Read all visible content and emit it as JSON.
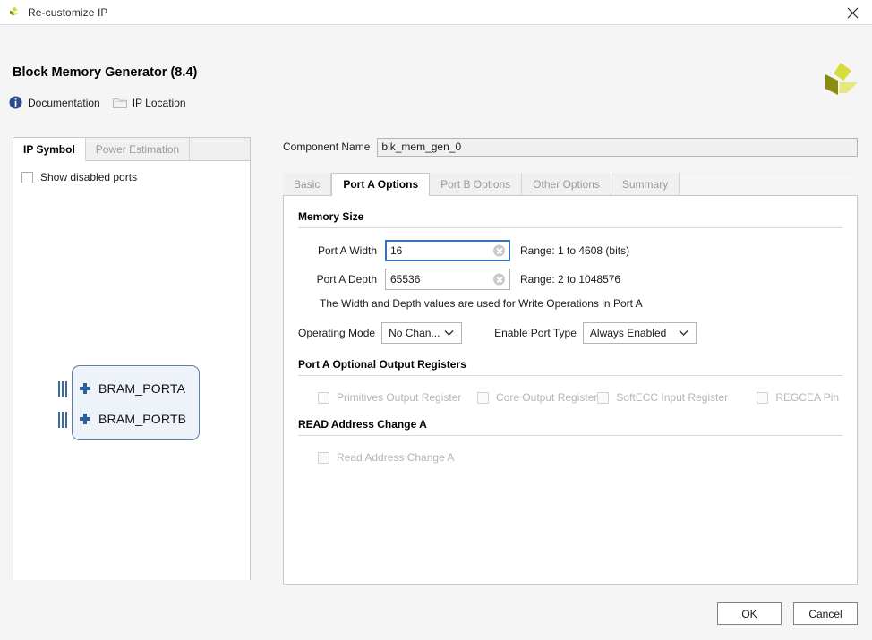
{
  "window": {
    "title": "Re-customize IP",
    "app_icon": "xilinx-logo-icon",
    "close_icon": "close-icon"
  },
  "header": {
    "title": "Block Memory Generator (8.4)",
    "logo_icon": "xilinx-pinwheel-logo"
  },
  "links": [
    {
      "label": "Documentation",
      "icon": "info-icon"
    },
    {
      "label": "IP Location",
      "icon": "folder-icon"
    }
  ],
  "left_panel": {
    "tabs": [
      {
        "label": "IP Symbol",
        "active": true
      },
      {
        "label": "Power Estimation",
        "active": false
      }
    ],
    "show_disabled_ports": {
      "label": "Show disabled ports",
      "checked": false
    },
    "symbol": {
      "ports": [
        {
          "label": "BRAM_PORTA",
          "expand_icon": "plus-icon"
        },
        {
          "label": "BRAM_PORTB",
          "expand_icon": "plus-icon"
        }
      ]
    }
  },
  "main": {
    "component_name": {
      "label": "Component Name",
      "value": "blk_mem_gen_0"
    },
    "tabs": [
      {
        "label": "Basic",
        "active": false
      },
      {
        "label": "Port A Options",
        "active": true
      },
      {
        "label": "Port B Options",
        "active": false
      },
      {
        "label": "Other Options",
        "active": false
      },
      {
        "label": "Summary",
        "active": false
      }
    ],
    "memory_size": {
      "section_title": "Memory Size",
      "width": {
        "label": "Port A Width",
        "value": "16",
        "range": "Range: 1 to 4608 (bits)",
        "clear_icon": "clear-icon"
      },
      "depth": {
        "label": "Port A Depth",
        "value": "65536",
        "range": "Range: 2 to 1048576",
        "clear_icon": "clear-icon"
      },
      "note": "The Width and Depth values are used for Write Operations in Port A",
      "operating_mode": {
        "label": "Operating Mode",
        "value": "No Chan...",
        "arrow_icon": "chevron-down-icon"
      },
      "enable_port_type": {
        "label": "Enable Port Type",
        "value": "Always Enabled",
        "arrow_icon": "chevron-down-icon"
      }
    },
    "optional_output_registers": {
      "section_title": "Port A Optional Output Registers",
      "items": [
        {
          "label": "Primitives Output Register",
          "checked": false,
          "disabled": true
        },
        {
          "label": "Core Output Register",
          "checked": false,
          "disabled": true
        },
        {
          "label": "SoftECC Input Register",
          "checked": false,
          "disabled": true
        },
        {
          "label": "REGCEA Pin",
          "checked": false,
          "disabled": true
        }
      ]
    },
    "read_address_change": {
      "section_title": "READ Address Change A",
      "items": [
        {
          "label": "Read Address Change A",
          "checked": false,
          "disabled": true
        }
      ]
    }
  },
  "footer": {
    "ok_label": "OK",
    "cancel_label": "Cancel"
  },
  "colors": {
    "accent_blue": "#3b6fb6",
    "symbol_border": "#5a7fa8",
    "symbol_fill": "#eef3fa",
    "logo_yellow": "#d6dd3a",
    "logo_olive": "#8a8c12",
    "disabled_text": "#b5b5b5",
    "window_bg": "#f5f5f5"
  }
}
